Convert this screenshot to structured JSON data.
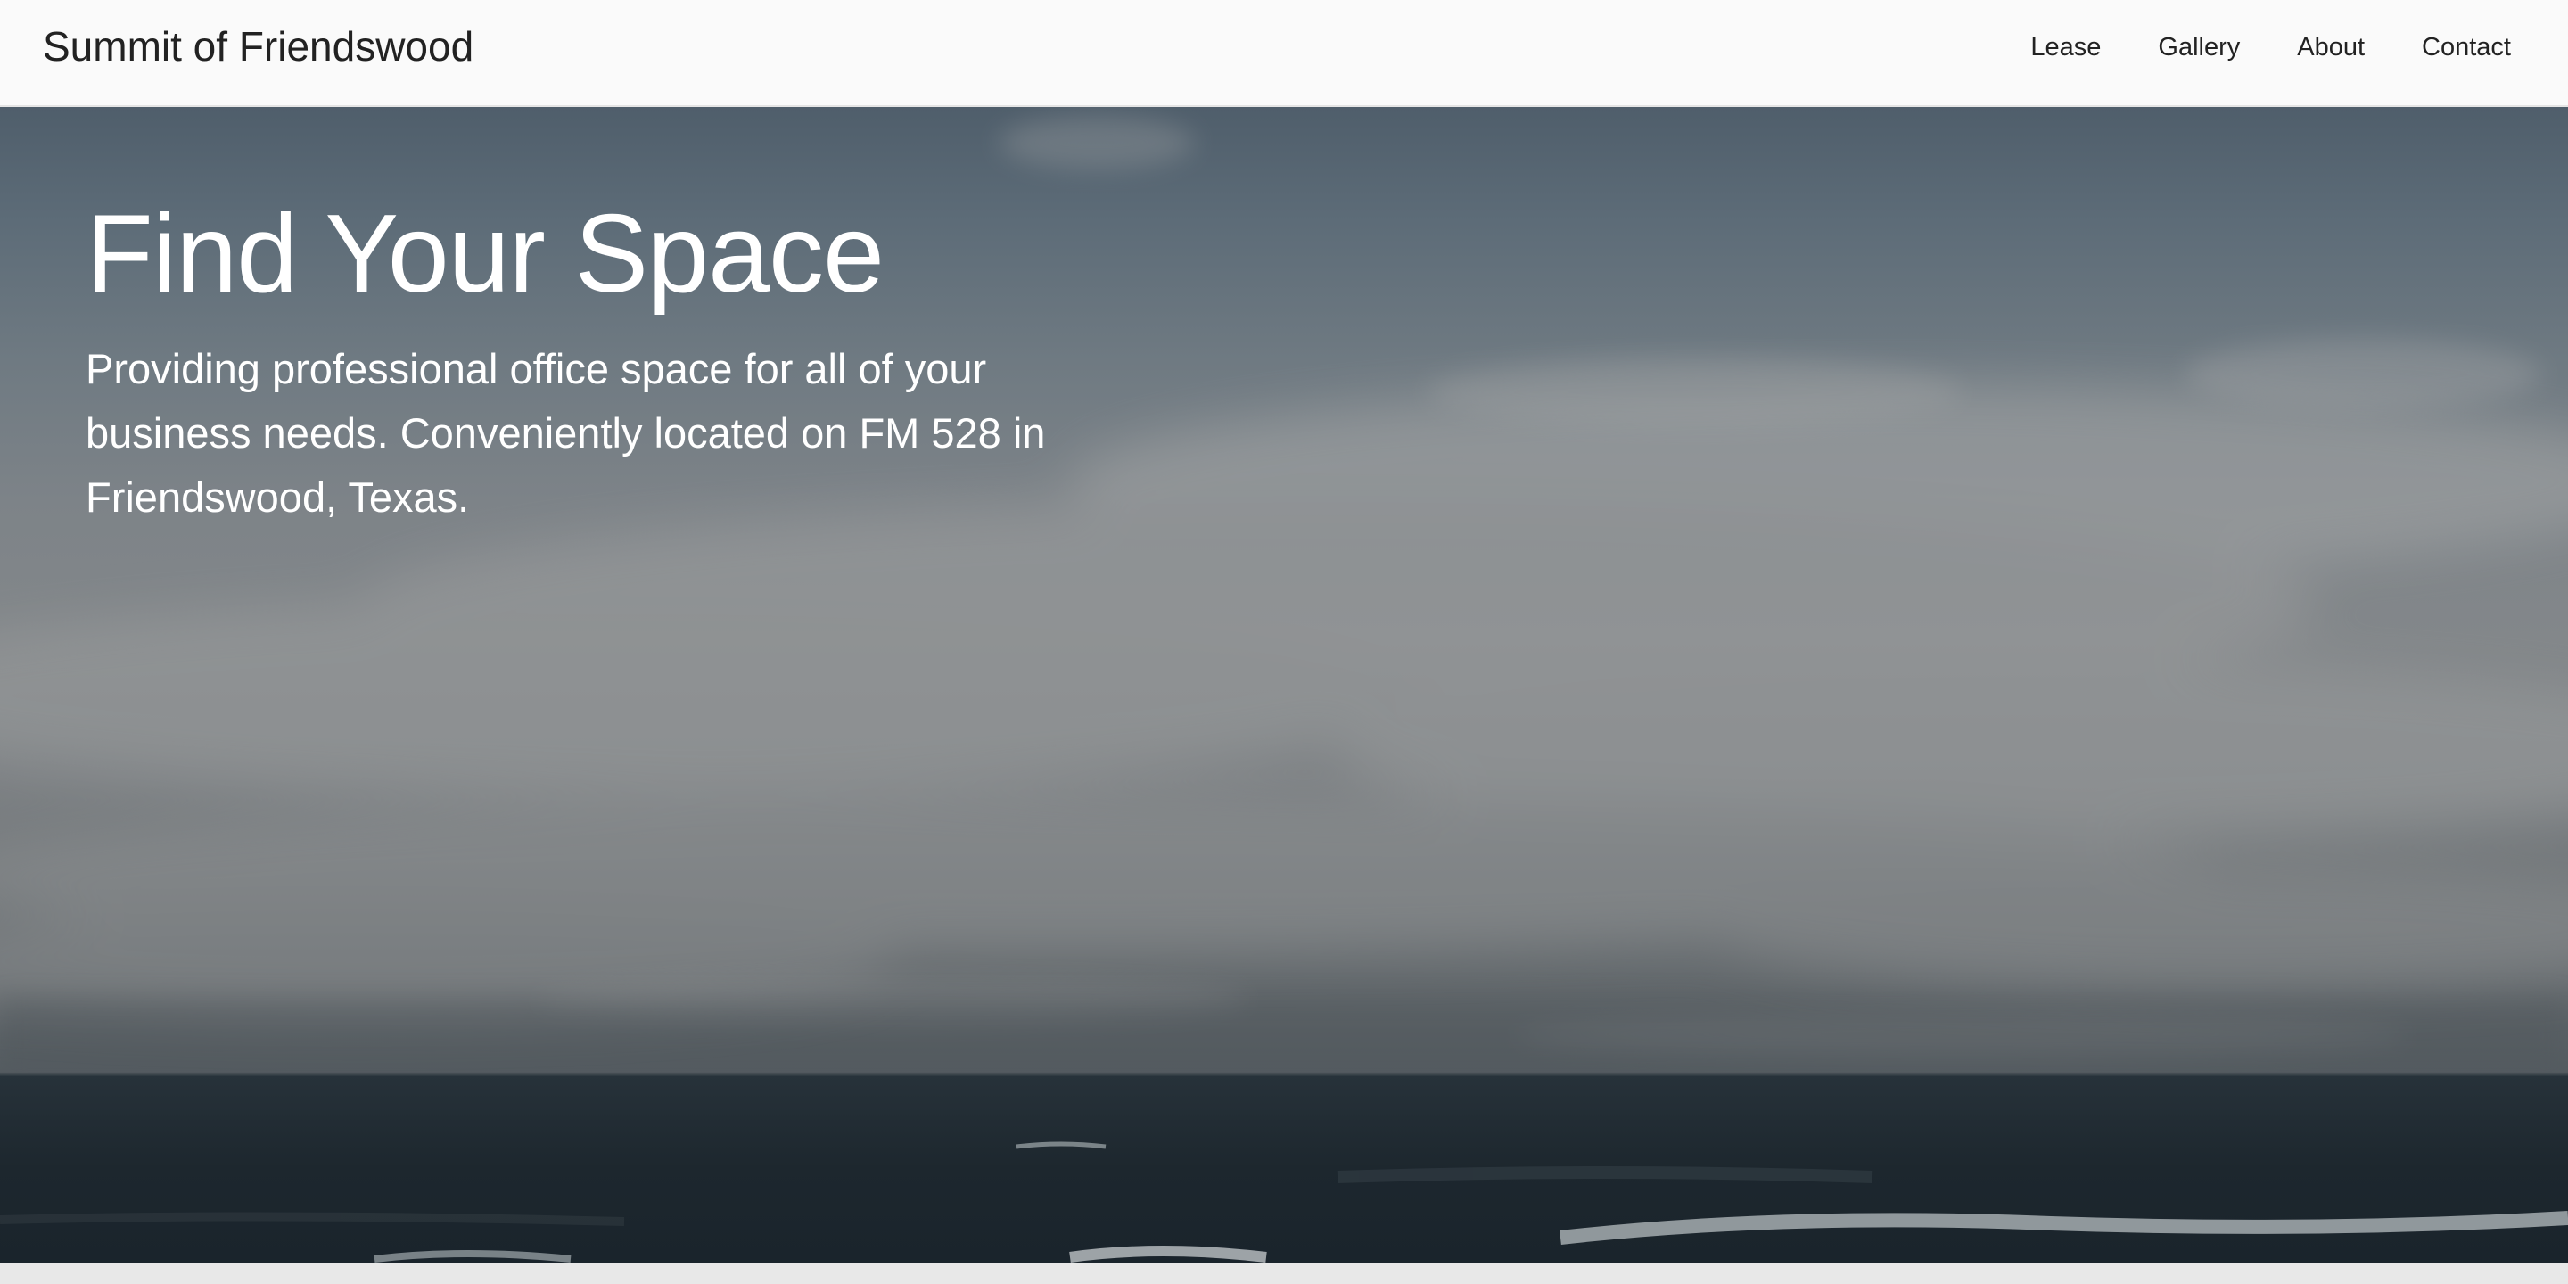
{
  "header": {
    "brand": "Summit of Friendswood",
    "nav": {
      "lease": "Lease",
      "gallery": "Gallery",
      "about": "About",
      "contact": "Contact"
    }
  },
  "hero": {
    "title": "Find Your Space",
    "subtitle": "Providing professional office space for all of your business needs. Conveniently located on FM 528 in Friendswood, Texas."
  },
  "colors": {
    "header_bg": "#fafafa",
    "text_dark": "#222222",
    "hero_text": "#ffffff",
    "sky": "#6f7a82",
    "ocean": "#1c252b"
  }
}
